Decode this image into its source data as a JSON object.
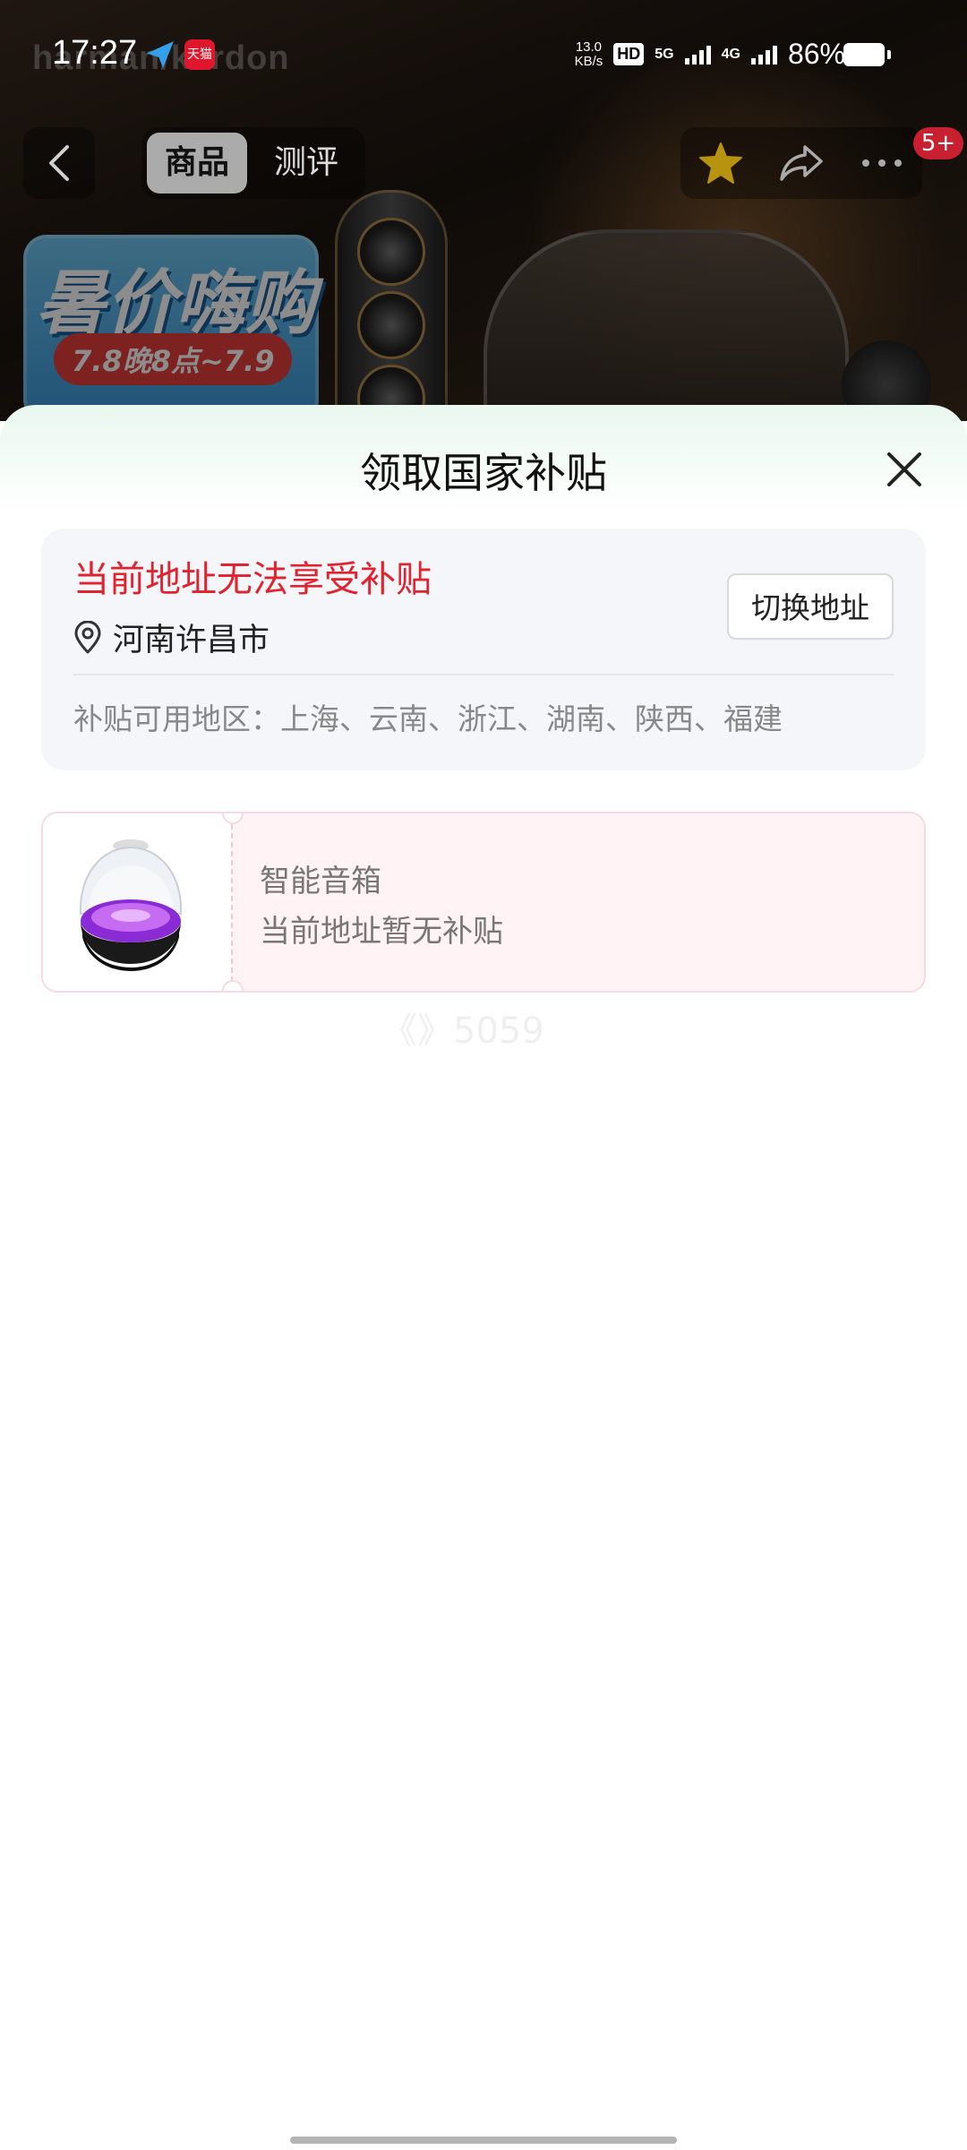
{
  "status_bar": {
    "time": "17:27",
    "tmall_icon_text": "天猫",
    "net_speed_value": "13.0",
    "net_speed_unit": "KB/s",
    "hd_label": "HD",
    "sim1_label": "5G",
    "sim2_label": "4G",
    "battery_percent": "86%"
  },
  "background_page": {
    "brand_watermark": "harman/kardon",
    "promo_title": "暑价嗨购",
    "promo_date": "7.8晚8点~7.9"
  },
  "nav": {
    "tabs": [
      {
        "label": "商品",
        "active": true
      },
      {
        "label": "测评",
        "active": false
      }
    ],
    "notification_badge": "5+",
    "favorite_color": "#e8b800"
  },
  "sheet": {
    "title": "领取国家补贴",
    "address": {
      "warning": "当前地址无法享受补贴",
      "location": "河南许昌市",
      "switch_button": "切换地址",
      "available_regions": "补贴可用地区：上海、云南、浙江、湖南、陕西、福建"
    },
    "coupon": {
      "product_name": "智能音箱",
      "status": "当前地址暂无补贴"
    },
    "watermark": "《》5059"
  },
  "colors": {
    "warning_red": "#e0232f",
    "sheet_gradient_top": "#e9f8ef",
    "coupon_bg": "#fff3f6"
  }
}
